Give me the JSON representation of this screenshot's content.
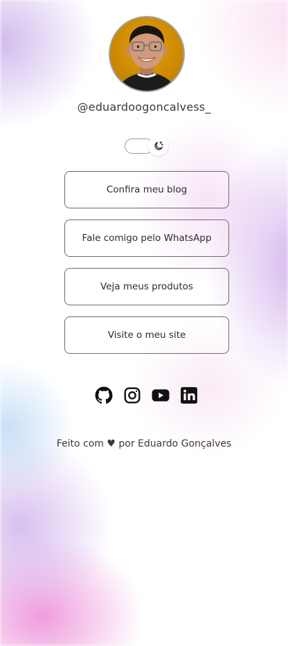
{
  "profile": {
    "username": "@eduardoogoncalvess_"
  },
  "theme_toggle": {
    "icon": "moon-icon"
  },
  "links": [
    {
      "label": "Confira meu blog"
    },
    {
      "label": "Fale comigo pelo WhatsApp"
    },
    {
      "label": "Veja meus produtos"
    },
    {
      "label": "Visite o meu site"
    }
  ],
  "social": [
    {
      "icon": "github-icon"
    },
    {
      "icon": "instagram-icon"
    },
    {
      "icon": "youtube-icon"
    },
    {
      "icon": "linkedin-icon"
    }
  ],
  "footer": {
    "text": "Feito com ♥ por Eduardo Gonçalves"
  },
  "colors": {
    "border": "#6a6a6a",
    "text": "#2b2b2b",
    "avatar_bg": "#d99400"
  }
}
